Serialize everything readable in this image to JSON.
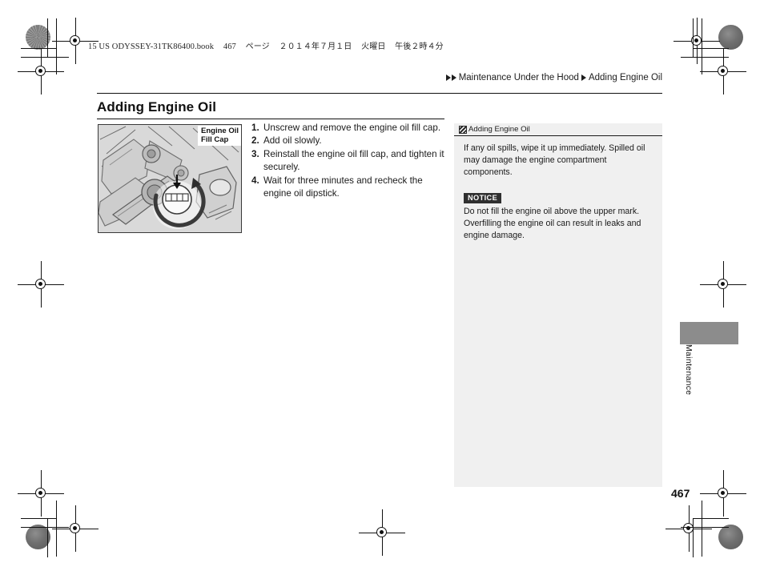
{
  "imposition_header": {
    "file": "15 US ODYSSEY-31TK86400.book",
    "page_label": "467",
    "page_unit": "ページ",
    "date": "２０１４年７月１日",
    "weekday": "火曜日",
    "time": "午後２時４分"
  },
  "breadcrumb": {
    "section": "Maintenance Under the Hood",
    "topic": "Adding Engine Oil"
  },
  "title": "Adding Engine Oil",
  "illustration": {
    "label_line1": "Engine Oil",
    "label_line2": "Fill Cap",
    "alt": "engine-bay-oil-fill-cap"
  },
  "steps": [
    {
      "num": "1.",
      "text": "Unscrew and remove the engine oil fill cap."
    },
    {
      "num": "2.",
      "text": "Add oil slowly."
    },
    {
      "num": "3.",
      "text": "Reinstall the engine oil fill cap, and tighten it securely."
    },
    {
      "num": "4.",
      "text": "Wait for three minutes and recheck the engine oil dipstick."
    }
  ],
  "sidepanel": {
    "heading": "Adding Engine Oil",
    "paragraph": "If any oil spills, wipe it up immediately. Spilled oil may damage the engine compartment components.",
    "notice_label": "NOTICE",
    "notice_text": "Do not fill the engine oil above the upper mark. Overfilling the engine oil can result in leaks and engine damage."
  },
  "thumb_tab": {
    "label": "Maintenance",
    "color": "#8c8c8c"
  },
  "page_number": "467",
  "colors": {
    "panel_bg": "#f0f0f0",
    "illustration_bg": "#d9d9d9",
    "rule": "#111111",
    "notice_bg": "#2f2f2f"
  }
}
